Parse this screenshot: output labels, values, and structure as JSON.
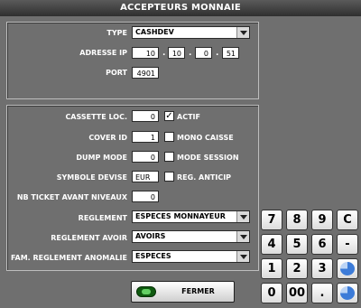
{
  "window": {
    "title": "ACCEPTEURS MONNAIE"
  },
  "device": {
    "type_label": "TYPE",
    "type_value": "CASHDEV",
    "ip_label": "ADRESSE IP",
    "ip": [
      "10",
      "10",
      "0",
      "51"
    ],
    "ip_sep": ".",
    "port_label": "PORT",
    "port_value": "4901"
  },
  "config": {
    "cassette_label": "CASSETTE LOC.",
    "cassette_value": "0",
    "actif_label": "ACTIF",
    "actif_checked": true,
    "actif_mark": "✓",
    "cover_label": "COVER ID",
    "cover_value": "1",
    "mono_label": "MONO CAISSE",
    "mono_checked": false,
    "dump_label": "DUMP MODE",
    "dump_value": "0",
    "session_label": "MODE SESSION",
    "session_checked": false,
    "devise_label": "SYMBOLE DEVISE",
    "devise_value": "EUR",
    "anticip_label": "REG. ANTICIP",
    "anticip_checked": false,
    "ticket_label": "NB TICKET AVANT NIVEAUX",
    "ticket_value": "0",
    "reglement_label": "REGLEMENT",
    "reglement_value": "ESPECES MONNAYEUR",
    "avoir_label": "REGLEMENT AVOIR",
    "avoir_value": "AVOIRS",
    "anomalie_label": "FAM. REGLEMENT ANOMALIE",
    "anomalie_value": "ESPECES"
  },
  "keypad": {
    "keys": [
      "7",
      "8",
      "9",
      "C",
      "4",
      "5",
      "6",
      "-",
      "1",
      "2",
      "3",
      "",
      "0",
      "00",
      ".",
      ""
    ],
    "icons": [
      "pie-chart-icon",
      "pie-chart-icon"
    ],
    "icon_colors": {
      "fill": "#3c7bd8",
      "light": "#bcd4f5"
    }
  },
  "footer": {
    "close_label": "FERMER",
    "close_icon": "green-pill-icon"
  }
}
